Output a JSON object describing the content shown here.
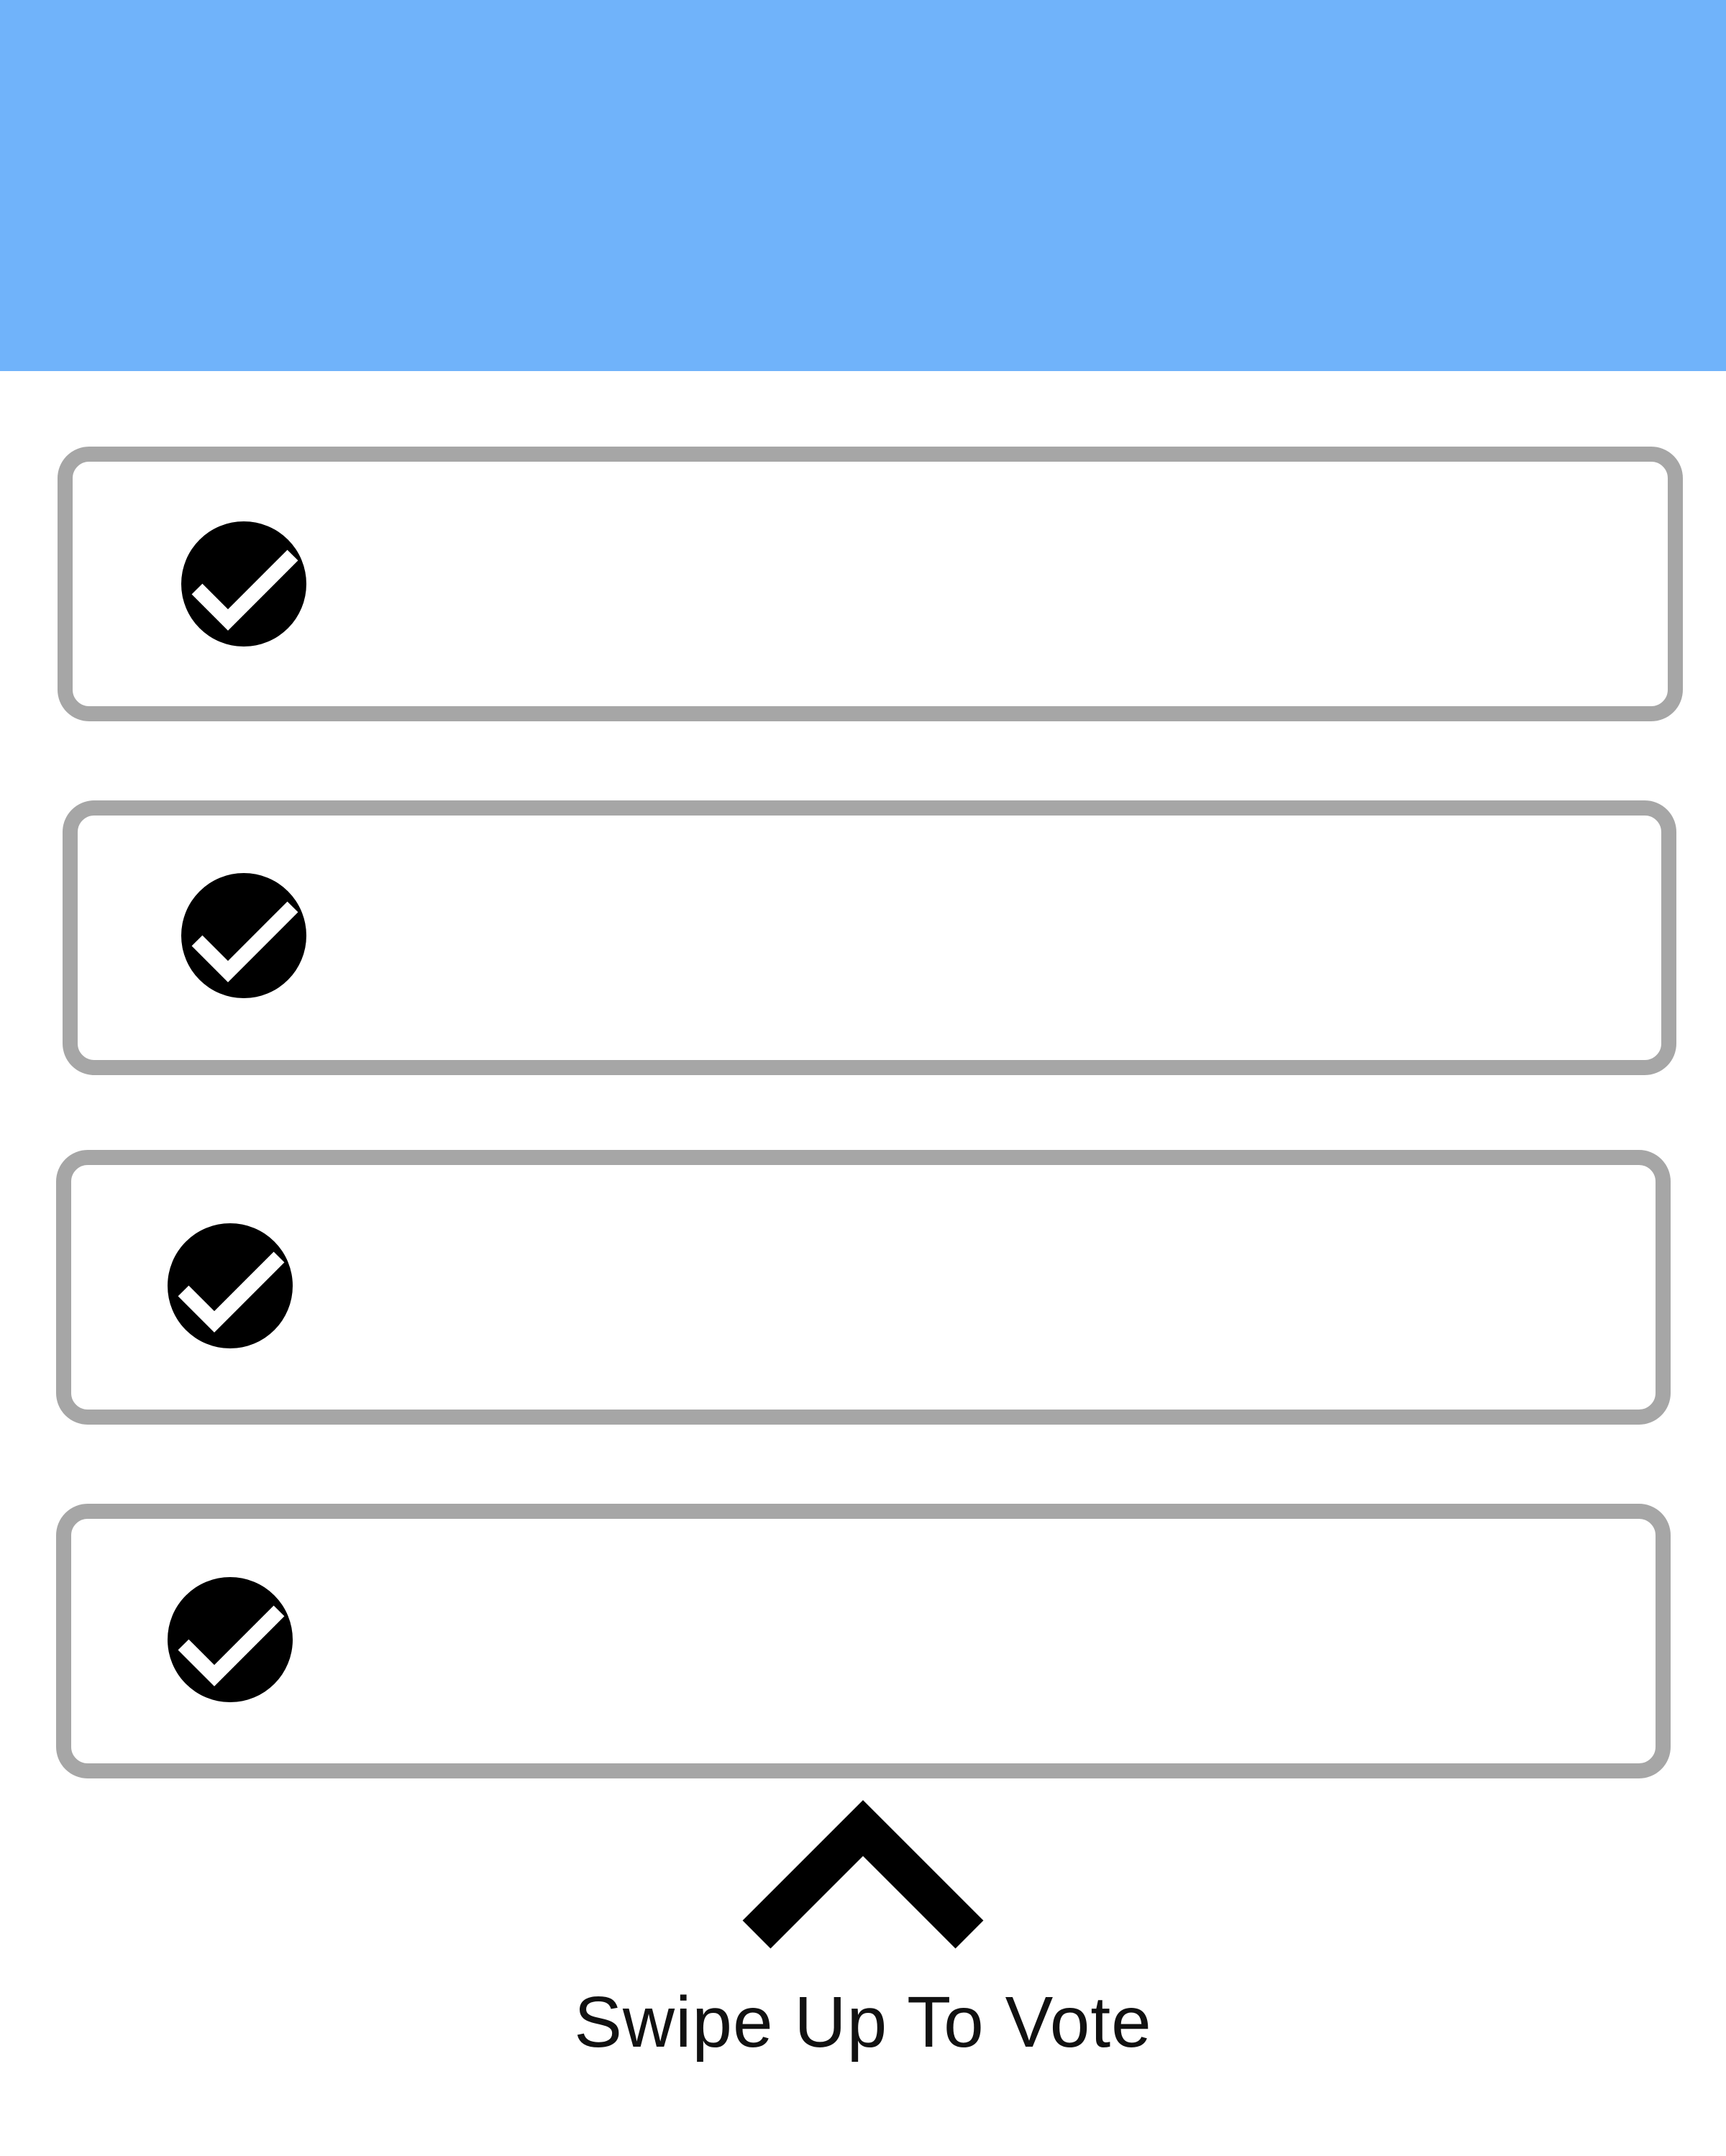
{
  "header": {
    "title": "",
    "color": "#70b3fa"
  },
  "options": [
    {
      "label": "",
      "icon": "check-circle-icon"
    },
    {
      "label": "",
      "icon": "check-circle-icon"
    },
    {
      "label": "",
      "icon": "check-circle-icon"
    },
    {
      "label": "",
      "icon": "check-circle-icon"
    }
  ],
  "swipe": {
    "icon": "chevron-up-icon",
    "label": "Swipe Up To Vote"
  },
  "colors": {
    "card_border": "#a6a6a6",
    "icon": "#000000",
    "background": "#ffffff"
  }
}
